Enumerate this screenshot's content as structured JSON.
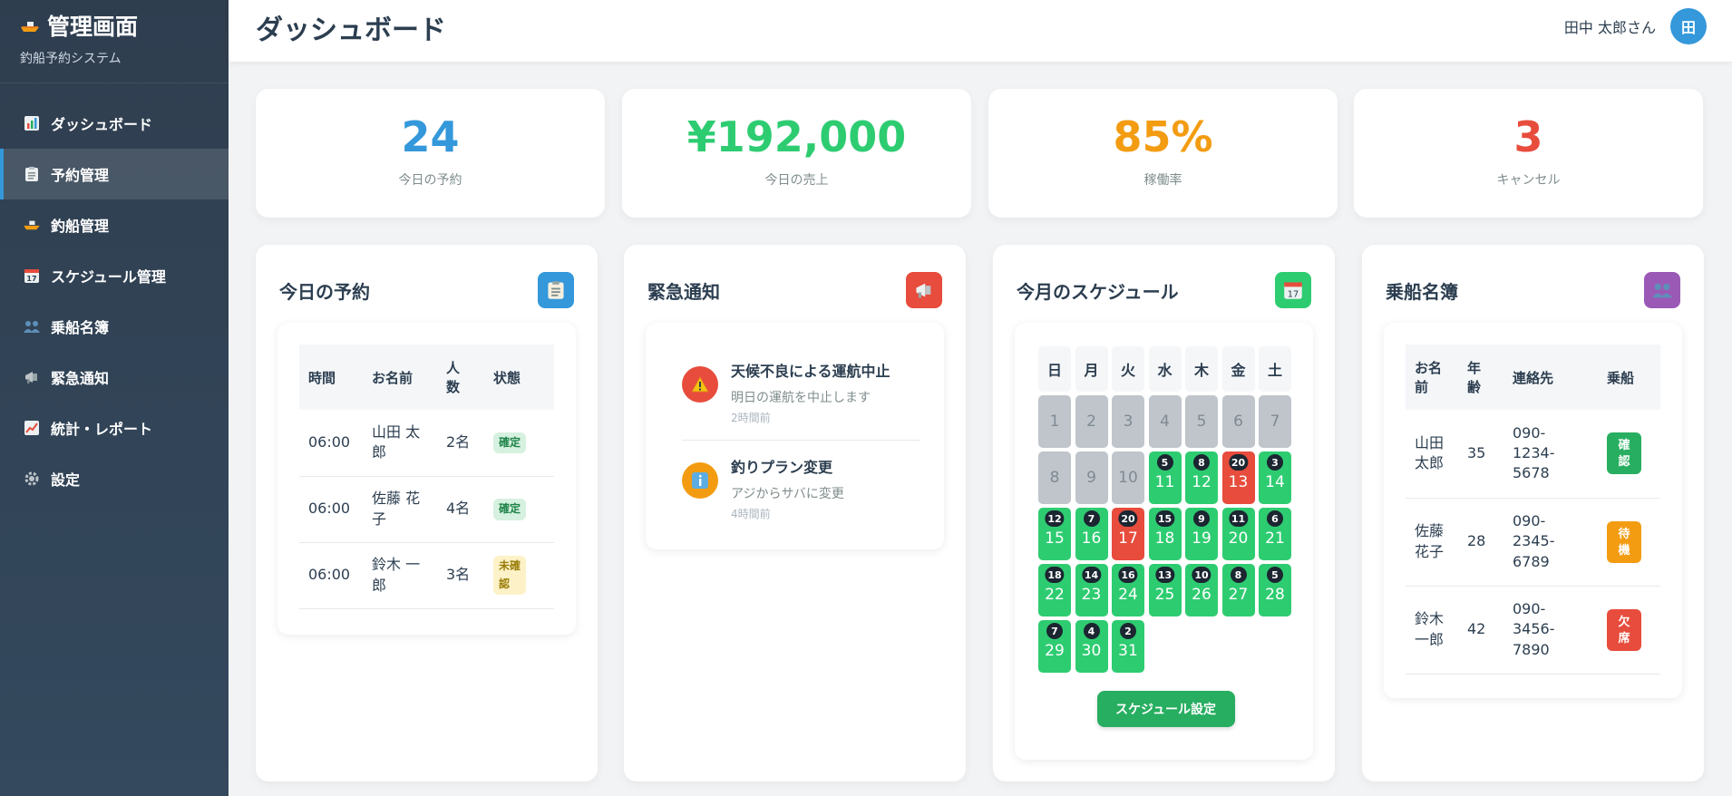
{
  "sidebar": {
    "title": "管理画面",
    "subtitle": "釣船予約システム",
    "items": [
      {
        "label": "ダッシュボード",
        "icon": "chart-icon"
      },
      {
        "label": "予約管理",
        "icon": "clipboard-icon"
      },
      {
        "label": "釣船管理",
        "icon": "boat-icon"
      },
      {
        "label": "スケジュール管理",
        "icon": "calendar-icon"
      },
      {
        "label": "乗船名簿",
        "icon": "people-icon"
      },
      {
        "label": "緊急通知",
        "icon": "megaphone-icon"
      },
      {
        "label": "統計・レポート",
        "icon": "trend-icon"
      },
      {
        "label": "設定",
        "icon": "gear-icon"
      }
    ]
  },
  "header": {
    "title": "ダッシュボード",
    "user_name": "田中 太郎さん",
    "avatar_initial": "田"
  },
  "stats": [
    {
      "value": "24",
      "label": "今日の予約",
      "color": "#3498db"
    },
    {
      "value": "¥192,000",
      "label": "今日の売上",
      "color": "#2ecc71"
    },
    {
      "value": "85%",
      "label": "稼働率",
      "color": "#f39c12"
    },
    {
      "value": "3",
      "label": "キャンセル",
      "color": "#e74c3c"
    }
  ],
  "reservations": {
    "title": "今日の予約",
    "columns": {
      "time": "時間",
      "name": "お名前",
      "people_line1": "人",
      "people_line2": "数",
      "status": "状態"
    },
    "rows": [
      {
        "time": "06:00",
        "name_l1": "山田 太",
        "name_l2": "郎",
        "people": "2名",
        "status_l1": "確定",
        "status_l2": "",
        "status_type": "ok"
      },
      {
        "time": "06:00",
        "name_l1": "佐藤 花",
        "name_l2": "子",
        "people": "4名",
        "status_l1": "確定",
        "status_l2": "",
        "status_type": "ok"
      },
      {
        "time": "06:00",
        "name_l1": "鈴木 一",
        "name_l2": "郎",
        "people": "3名",
        "status_l1": "未確",
        "status_l2": "認",
        "status_type": "wait"
      }
    ]
  },
  "notices": {
    "title": "緊急通知",
    "items": [
      {
        "title": "天候不良による運航中止",
        "desc": "明日の運航を中止します",
        "time": "2時間前",
        "icon": "warning-icon",
        "color": "#e74c3c"
      },
      {
        "title": "釣りプラン変更",
        "desc": "アジからサバに変更",
        "time": "4時間前",
        "icon": "info-icon",
        "color": "#f39c12"
      }
    ]
  },
  "schedule": {
    "title": "今月のスケジュール",
    "weekdays": [
      "日",
      "月",
      "火",
      "水",
      "木",
      "金",
      "土"
    ],
    "days": [
      {
        "d": "1",
        "s": "past",
        "c": ""
      },
      {
        "d": "2",
        "s": "past",
        "c": ""
      },
      {
        "d": "3",
        "s": "past",
        "c": ""
      },
      {
        "d": "4",
        "s": "past",
        "c": ""
      },
      {
        "d": "5",
        "s": "past",
        "c": ""
      },
      {
        "d": "6",
        "s": "past",
        "c": ""
      },
      {
        "d": "7",
        "s": "past",
        "c": ""
      },
      {
        "d": "8",
        "s": "past",
        "c": ""
      },
      {
        "d": "9",
        "s": "past",
        "c": ""
      },
      {
        "d": "10",
        "s": "past",
        "c": ""
      },
      {
        "d": "11",
        "s": "open",
        "c": "5"
      },
      {
        "d": "12",
        "s": "open",
        "c": "8"
      },
      {
        "d": "13",
        "s": "full",
        "c": "20"
      },
      {
        "d": "14",
        "s": "open",
        "c": "3"
      },
      {
        "d": "15",
        "s": "open",
        "c": "12"
      },
      {
        "d": "16",
        "s": "open",
        "c": "7"
      },
      {
        "d": "17",
        "s": "full",
        "c": "20"
      },
      {
        "d": "18",
        "s": "open",
        "c": "15"
      },
      {
        "d": "19",
        "s": "open",
        "c": "9"
      },
      {
        "d": "20",
        "s": "open",
        "c": "11"
      },
      {
        "d": "21",
        "s": "open",
        "c": "6"
      },
      {
        "d": "22",
        "s": "open",
        "c": "18"
      },
      {
        "d": "23",
        "s": "open",
        "c": "14"
      },
      {
        "d": "24",
        "s": "open",
        "c": "16"
      },
      {
        "d": "25",
        "s": "open",
        "c": "13"
      },
      {
        "d": "26",
        "s": "open",
        "c": "10"
      },
      {
        "d": "27",
        "s": "open",
        "c": "8"
      },
      {
        "d": "28",
        "s": "open",
        "c": "5"
      },
      {
        "d": "29",
        "s": "open",
        "c": "7"
      },
      {
        "d": "30",
        "s": "open",
        "c": "4"
      },
      {
        "d": "31",
        "s": "open",
        "c": "2"
      }
    ],
    "button_label": "スケジュール設定"
  },
  "roster": {
    "title": "乗船名簿",
    "columns": {
      "name_l1": "お名",
      "name_l2": "前",
      "age_l1": "年",
      "age_l2": "齢",
      "contact": "連絡先",
      "boarding": "乗船"
    },
    "rows": [
      {
        "name_l1": "山田",
        "name_l2": "太郎",
        "age": "35",
        "tel1": "090-",
        "tel2": "1234-",
        "tel3": "5678",
        "b1": "確",
        "b2": "認",
        "color": "#27ae60"
      },
      {
        "name_l1": "佐藤",
        "name_l2": "花子",
        "age": "28",
        "tel1": "090-",
        "tel2": "2345-",
        "tel3": "6789",
        "b1": "待",
        "b2": "機",
        "color": "#f39c12"
      },
      {
        "name_l1": "鈴木",
        "name_l2": "一郎",
        "age": "42",
        "tel1": "090-",
        "tel2": "3456-",
        "tel3": "7890",
        "b1": "欠",
        "b2": "席",
        "color": "#e74c3c"
      }
    ]
  }
}
